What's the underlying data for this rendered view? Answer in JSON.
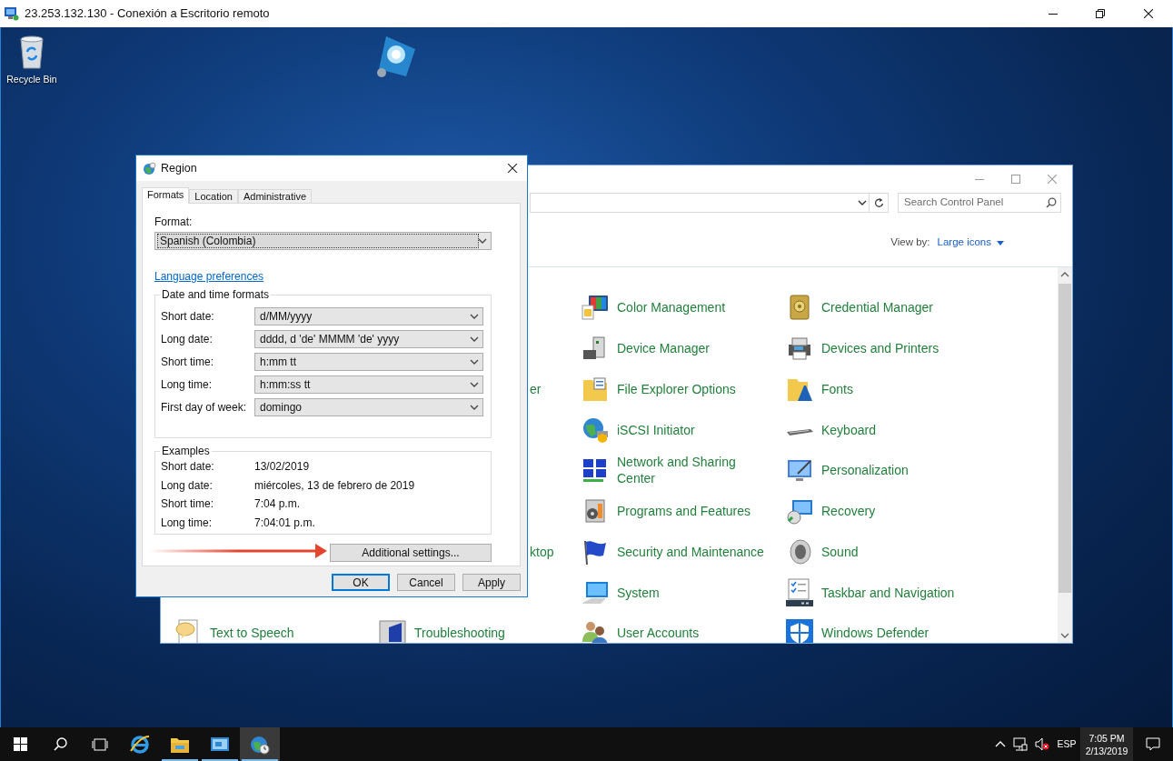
{
  "remote_desktop": {
    "title": "23.253.132.130 - Conexión a Escritorio remoto"
  },
  "desktop_icons": [
    {
      "label": "Recycle Bin"
    }
  ],
  "control_panel": {
    "search": {
      "placeholder": "Search Control Panel"
    },
    "view_by": {
      "label": "View by:",
      "value": "Large icons"
    },
    "rows": [
      {
        "items": [
          {
            "kind": "item",
            "label": "Color Management"
          },
          {
            "kind": "item",
            "label": "Credential Manager"
          }
        ]
      },
      {
        "items": [
          {
            "kind": "item",
            "label": "Device Manager"
          },
          {
            "kind": "item",
            "label": "Devices and Printers"
          }
        ]
      },
      {
        "items": [
          {
            "kind": "fragment",
            "label": "er"
          },
          {
            "kind": "item",
            "label": "File Explorer Options"
          },
          {
            "kind": "item",
            "label": "Fonts"
          }
        ]
      },
      {
        "items": [
          {
            "kind": "item",
            "label": "iSCSI Initiator"
          },
          {
            "kind": "item",
            "label": "Keyboard"
          }
        ]
      },
      {
        "items": [
          {
            "kind": "item",
            "label": "Network and Sharing Center"
          },
          {
            "kind": "item",
            "label": "Personalization"
          }
        ]
      },
      {
        "items": [
          {
            "kind": "item",
            "label": "Programs and Features"
          },
          {
            "kind": "item",
            "label": "Recovery"
          }
        ]
      },
      {
        "items": [
          {
            "kind": "fragment",
            "label": "ktop"
          },
          {
            "kind": "item",
            "label": "Security and Maintenance"
          },
          {
            "kind": "item",
            "label": "Sound"
          }
        ]
      },
      {
        "items": [
          {
            "kind": "item",
            "label": "System"
          },
          {
            "kind": "item",
            "label": "Taskbar and Navigation"
          }
        ]
      },
      {
        "items": [
          {
            "kind": "item",
            "label": "Text to Speech"
          },
          {
            "kind": "item",
            "label": "Troubleshooting"
          },
          {
            "kind": "item",
            "label": "User Accounts"
          },
          {
            "kind": "item",
            "label": "Windows Defender"
          }
        ]
      }
    ]
  },
  "region_dialog": {
    "title": "Region",
    "tabs": [
      {
        "label": "Formats",
        "selected": true
      },
      {
        "label": "Location",
        "selected": false
      },
      {
        "label": "Administrative",
        "selected": false
      }
    ],
    "format": {
      "label": "Format:",
      "value": "Spanish (Colombia)",
      "focused": true
    },
    "language_link": "Language preferences",
    "date_time_formats": {
      "title": "Date and time formats",
      "fields": [
        {
          "label": "Short date:",
          "value": "d/MM/yyyy"
        },
        {
          "label": "Long date:",
          "value": "dddd, d 'de' MMMM 'de' yyyy"
        },
        {
          "label": "Short time:",
          "value": "h:mm tt"
        },
        {
          "label": "Long time:",
          "value": "h:mm:ss tt"
        },
        {
          "label": "First day of week:",
          "value": "domingo"
        }
      ]
    },
    "examples": {
      "title": "Examples",
      "rows": [
        {
          "label": "Short date:",
          "value": "13/02/2019"
        },
        {
          "label": "Long date:",
          "value": "miércoles, 13 de febrero de 2019"
        },
        {
          "label": "Short time:",
          "value": "7:04 p.m."
        },
        {
          "label": "Long time:",
          "value": "7:04:01 p.m."
        }
      ]
    },
    "additional_settings_button": "Additional settings...",
    "buttons": [
      {
        "label": "OK",
        "default": true
      },
      {
        "label": "Cancel",
        "default": false
      },
      {
        "label": "Apply",
        "default": false
      }
    ]
  },
  "taskbar": {
    "apps": [
      {
        "running": false,
        "selected": false
      },
      {
        "running": true,
        "selected": false
      },
      {
        "running": true,
        "selected": false
      },
      {
        "running": true,
        "selected": true
      }
    ],
    "input_language": "ESP",
    "time": "7:05 PM",
    "date": "2/13/2019"
  }
}
